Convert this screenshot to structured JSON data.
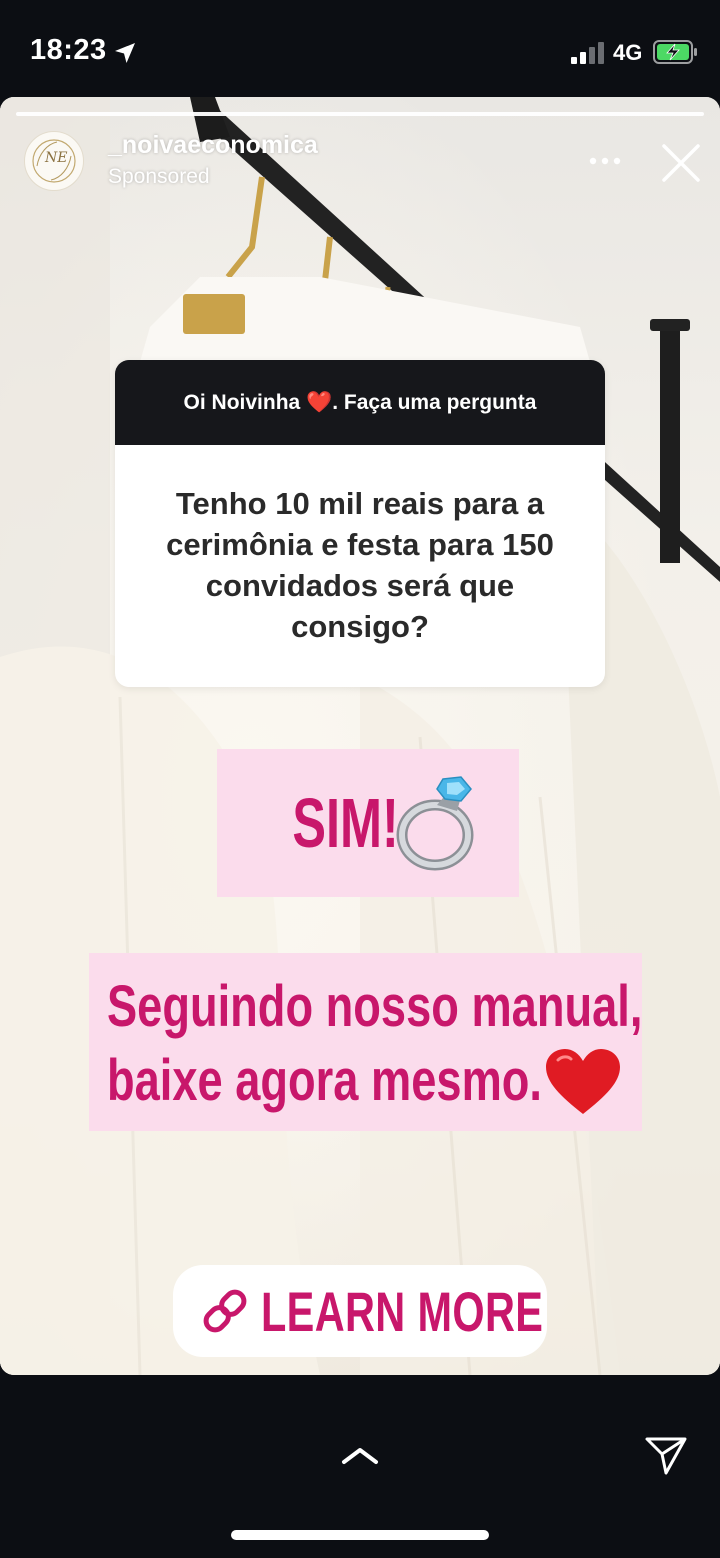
{
  "status_bar": {
    "time": "18:23",
    "network": "4G",
    "icons": [
      "location-arrow-icon",
      "signal-bars-icon",
      "battery-charging-icon"
    ]
  },
  "story": {
    "username": "_noivaeconomica",
    "sponsored_label": "Sponsored",
    "avatar_monogram": "NE",
    "question_sticker": {
      "header_prefix": "Oi Noivinha ",
      "header_emoji": "❤️",
      "header_suffix": ". Faça uma pergunta",
      "question": "Tenho 10 mil reais para a cerimônia e festa para 150 convidados será que consigo?"
    },
    "answer_text": "SIM!",
    "answer_emoji": "ring-icon",
    "manual_line_1": "Seguindo nosso manual,",
    "manual_line_2": "baixe agora mesmo.",
    "manual_emoji": "heart-icon",
    "cta_label": "LEARN MORE",
    "cta_icon": "link-icon"
  },
  "colors": {
    "accent_pink_text": "#c8176b",
    "pink_box": "#fbdcec",
    "sticker_header": "#16171b",
    "background": "#0c0e13"
  }
}
